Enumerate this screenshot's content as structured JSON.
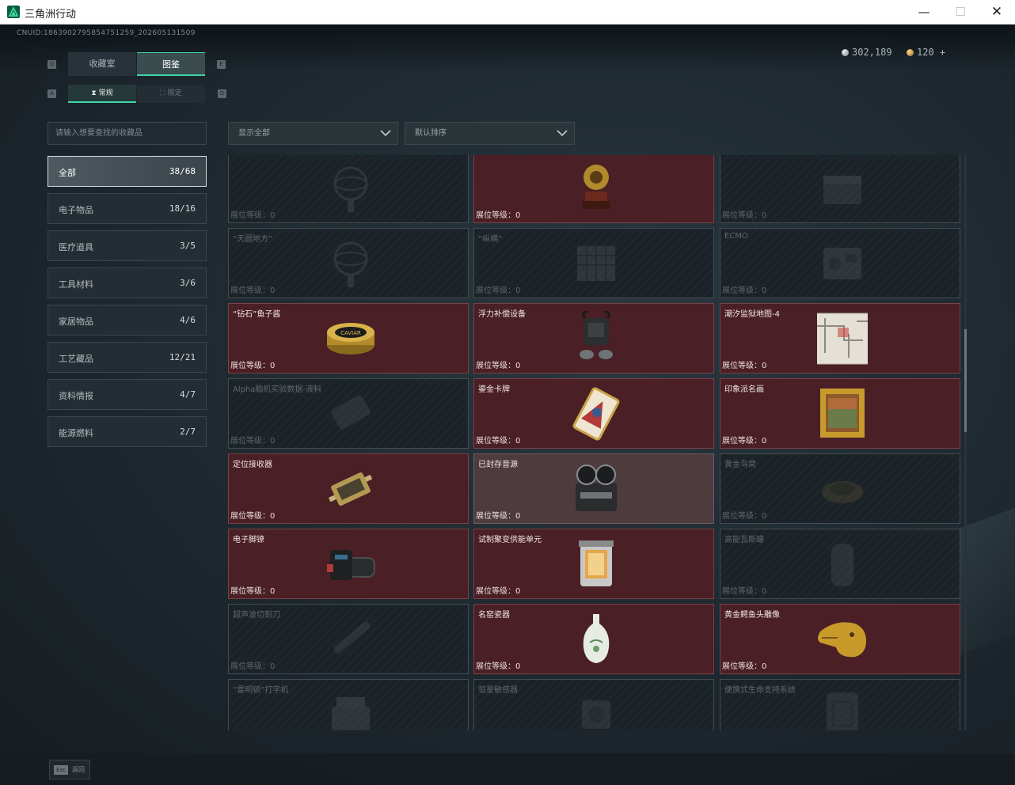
{
  "window": {
    "title": "三角洲行动",
    "min": "—",
    "max": "☐",
    "close": "✕"
  },
  "cnuid": "CNUID:1863902795854751259_202605131509",
  "currency": {
    "silver": "302,189",
    "gold": "120 +"
  },
  "tabs": {
    "key_left": "Q",
    "key_right": "E",
    "collection": "收藏室",
    "atlas": "图鉴"
  },
  "subtabs": {
    "key_left": "A",
    "key_right": "D",
    "normal": "常规",
    "limited": "限定"
  },
  "search": {
    "placeholder": "请输入想要查找的收藏品"
  },
  "filters": {
    "show": "显示全部",
    "sort": "默认排序"
  },
  "categories": [
    {
      "label": "全部",
      "count": "38/68"
    },
    {
      "label": "电子物品",
      "count": "18/16"
    },
    {
      "label": "医疗道具",
      "count": "3/5"
    },
    {
      "label": "工具材料",
      "count": "3/6"
    },
    {
      "label": "家居物品",
      "count": "4/6"
    },
    {
      "label": "工艺藏品",
      "count": "12/21"
    },
    {
      "label": "资料情报",
      "count": "4/7"
    },
    {
      "label": "能源燃料",
      "count": "2/7"
    }
  ],
  "level_label": "展位等级：0",
  "items": [
    {
      "name": "",
      "owned": false,
      "icon": "armillary-icon"
    },
    {
      "name": "",
      "owned": true,
      "icon": "gramophone-icon"
    },
    {
      "name": "",
      "owned": false,
      "icon": "chest-icon"
    },
    {
      "name": "“天圆地方”",
      "owned": false,
      "icon": "armillary-icon"
    },
    {
      "name": "“纵横”",
      "owned": false,
      "icon": "board-icon"
    },
    {
      "name": "ECMO",
      "owned": false,
      "icon": "machine-icon"
    },
    {
      "name": "“钻石”鱼子酱",
      "owned": true,
      "icon": "caviar-tin-icon"
    },
    {
      "name": "浮力补偿设备",
      "owned": true,
      "icon": "diving-gear-icon"
    },
    {
      "name": "潮汐监狱地图-4",
      "owned": true,
      "icon": "map-icon"
    },
    {
      "name": "Alpha脑机实验数据-液料",
      "owned": false,
      "icon": "data-drive-icon"
    },
    {
      "name": "鎏金卡牌",
      "owned": true,
      "icon": "gilded-card-icon"
    },
    {
      "name": "印象派名画",
      "owned": true,
      "icon": "framed-painting-icon"
    },
    {
      "name": "定位接收器",
      "owned": true,
      "icon": "receiver-icon"
    },
    {
      "name": "已封存音源",
      "owned": true,
      "dim": true,
      "icon": "reel-recorder-icon"
    },
    {
      "name": "黄金鸟窝",
      "owned": false,
      "icon": "nest-icon"
    },
    {
      "name": "电子脚镣",
      "owned": true,
      "icon": "ankle-monitor-icon"
    },
    {
      "name": "试制聚变供能单元",
      "owned": true,
      "icon": "fusion-cell-icon"
    },
    {
      "name": "高能瓦斯罐",
      "owned": false,
      "icon": "gas-tank-icon"
    },
    {
      "name": "超声波切割刀",
      "owned": false,
      "icon": "cutter-icon"
    },
    {
      "name": "名窑瓷器",
      "owned": true,
      "icon": "porcelain-vase-icon"
    },
    {
      "name": "黄金鳄鱼头雕像",
      "owned": true,
      "icon": "crocodile-head-icon"
    },
    {
      "name": "“雷明顿”打字机",
      "owned": false,
      "icon": "typewriter-icon"
    },
    {
      "name": "恒星敏感器",
      "owned": false,
      "icon": "sensor-icon"
    },
    {
      "name": "便携式生命支持系统",
      "owned": false,
      "icon": "life-support-icon"
    }
  ],
  "bottom": {
    "esc_key": "Esc",
    "back_label": "返回"
  }
}
